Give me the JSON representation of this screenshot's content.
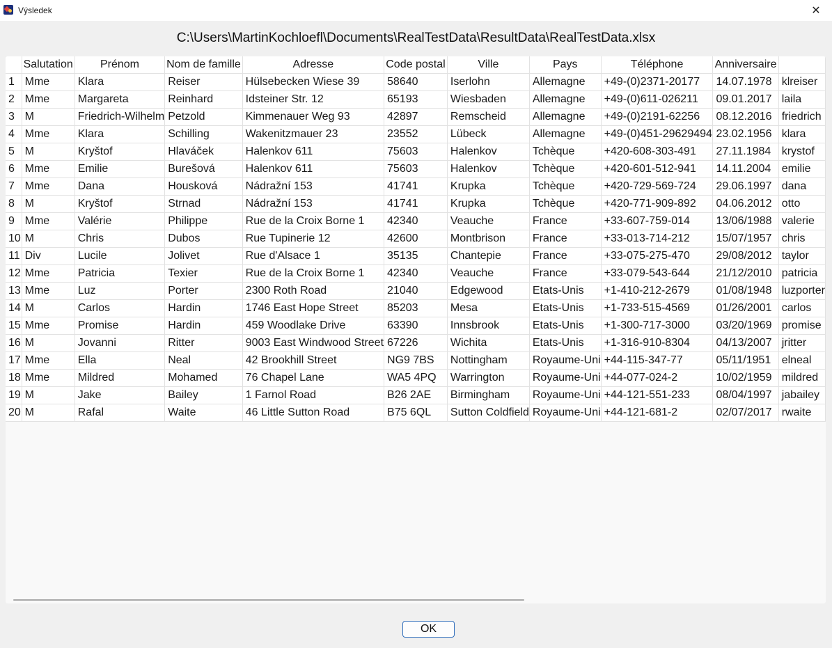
{
  "window": {
    "title": "Výsledek",
    "close_glyph": "✕"
  },
  "file_path": "C:\\Users\\MartinKochloefl\\Documents\\RealTestData\\ResultData\\RealTestData.xlsx",
  "table": {
    "columns": [
      "",
      "Salutation",
      "Prénom",
      "Nom de famille",
      "Adresse",
      "Code postal",
      "Ville",
      "Pays",
      "Téléphone",
      "Anniversaire",
      ""
    ],
    "rows": [
      [
        "1",
        "Mme",
        "Klara",
        "Reiser",
        "Hülsebecken Wiese 39",
        "58640",
        "Iserlohn",
        "Allemagne",
        "+49-(0)2371-20177",
        "14.07.1978",
        "klreiser"
      ],
      [
        "2",
        "Mme",
        "Margareta",
        "Reinhard",
        "Idsteiner Str. 12",
        "65193",
        "Wiesbaden",
        "Allemagne",
        "+49-(0)611-026211",
        "09.01.2017",
        "laila"
      ],
      [
        "3",
        "M",
        "Friedrich-Wilhelm",
        "Petzold",
        "Kimmenauer Weg 93",
        "42897",
        "Remscheid",
        "Allemagne",
        "+49-(0)2191-62256",
        "08.12.2016",
        "friedrich"
      ],
      [
        "4",
        "Mme",
        "Klara",
        "Schilling",
        "Wakenitzmauer 23",
        "23552",
        "Lübeck",
        "Allemagne",
        "+49-(0)451-29629494",
        "23.02.1956",
        "klara"
      ],
      [
        "5",
        "M",
        "Kryštof",
        "Hlaváček",
        "Halenkov 611",
        "75603",
        "Halenkov",
        "Tchèque",
        "+420-608-303-491",
        "27.11.1984",
        "krystof"
      ],
      [
        "6",
        "Mme",
        "Emilie",
        "Burešová",
        "Halenkov 611",
        "75603",
        "Halenkov",
        "Tchèque",
        "+420-601-512-941",
        "14.11.2004",
        "emilie"
      ],
      [
        "7",
        "Mme",
        "Dana",
        "Housková",
        "Nádražní 153",
        "41741",
        "Krupka",
        "Tchèque",
        "+420-729-569-724",
        "29.06.1997",
        "dana"
      ],
      [
        "8",
        "M",
        "Kryštof",
        "Strnad",
        "Nádražní 153",
        "41741",
        "Krupka",
        "Tchèque",
        "+420-771-909-892",
        "04.06.2012",
        "otto"
      ],
      [
        "9",
        "Mme",
        "Valérie",
        "Philippe",
        "Rue de la Croix Borne 1",
        "42340",
        "Veauche",
        "France",
        "+33-607-759-014",
        "13/06/1988",
        "valerie"
      ],
      [
        "10",
        "M",
        "Chris",
        "Dubos",
        "Rue Tupinerie 12",
        "42600",
        "Montbrison",
        "France",
        "+33-013-714-212",
        "15/07/1957",
        "chris"
      ],
      [
        "11",
        "Div",
        "Lucile",
        "Jolivet",
        "Rue d'Alsace 1",
        "35135",
        "Chantepie",
        "France",
        "+33-075-275-470",
        "29/08/2012",
        "taylor"
      ],
      [
        "12",
        "Mme",
        "Patricia",
        "Texier",
        "Rue de la Croix Borne 1",
        "42340",
        "Veauche",
        "France",
        "+33-079-543-644",
        "21/12/2010",
        "patricia"
      ],
      [
        "13",
        "Mme",
        "Luz",
        "Porter",
        "2300 Roth Road",
        "21040",
        "Edgewood",
        "Etats-Unis",
        "+1-410-212-2679",
        "01/08/1948",
        "luzporter"
      ],
      [
        "14",
        "M",
        "Carlos",
        "Hardin",
        "1746 East Hope Street",
        "85203",
        "Mesa",
        "Etats-Unis",
        "+1-733-515-4569",
        "01/26/2001",
        "carlos"
      ],
      [
        "15",
        "Mme",
        "Promise",
        "Hardin",
        "459 Woodlake Drive",
        "63390",
        "Innsbrook",
        "Etats-Unis",
        "+1-300-717-3000",
        "03/20/1969",
        "promise"
      ],
      [
        "16",
        "M",
        "Jovanni",
        "Ritter",
        "9003 East Windwood Street",
        "67226",
        "Wichita",
        "Etats-Unis",
        "+1-316-910-8304",
        "04/13/2007",
        "jritter"
      ],
      [
        "17",
        "Mme",
        "Ella",
        "Neal",
        "42 Brookhill Street",
        "NG9 7BS",
        "Nottingham",
        "Royaume-Uni",
        "+44-115-347-77",
        "05/11/1951",
        "elneal"
      ],
      [
        "18",
        "Mme",
        "Mildred",
        "Mohamed",
        "76 Chapel Lane",
        "WA5 4PQ",
        "Warrington",
        "Royaume-Uni",
        "+44-077-024-2",
        "10/02/1959",
        "mildred"
      ],
      [
        "19",
        "M",
        "Jake",
        "Bailey",
        "1 Farnol Road",
        "B26 2AE",
        "Birmingham",
        "Royaume-Uni",
        "+44-121-551-233",
        "08/04/1997",
        "jabailey"
      ],
      [
        "20",
        "M",
        "Rafal",
        "Waite",
        "46 Little Sutton Road",
        "B75 6QL",
        "Sutton Coldfield",
        "Royaume-Uni",
        "+44-121-681-2",
        "02/07/2017",
        "rwaite"
      ]
    ]
  },
  "buttons": {
    "ok": "OK"
  }
}
